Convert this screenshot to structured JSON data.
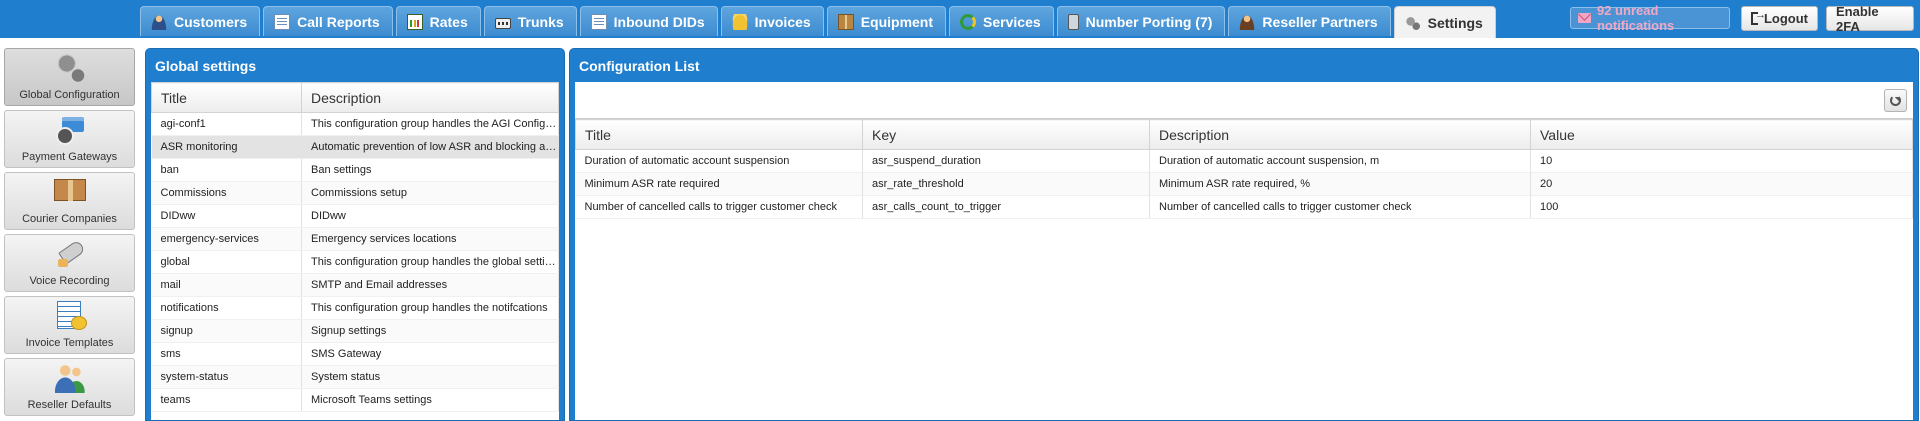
{
  "nav": {
    "tabs": [
      {
        "label": "Customers",
        "icon": "person-icon"
      },
      {
        "label": "Call Reports",
        "icon": "report-icon"
      },
      {
        "label": "Rates",
        "icon": "chart-icon"
      },
      {
        "label": "Trunks",
        "icon": "trunk-icon"
      },
      {
        "label": "Inbound DIDs",
        "icon": "did-icon"
      },
      {
        "label": "Invoices",
        "icon": "coins-icon"
      },
      {
        "label": "Equipment",
        "icon": "box-icon"
      },
      {
        "label": "Services",
        "icon": "services-icon"
      },
      {
        "label": "Number Porting (7)",
        "icon": "phone-icon"
      },
      {
        "label": "Reseller Partners",
        "icon": "reseller-icon"
      },
      {
        "label": "Settings",
        "icon": "gears-icon",
        "active": true
      }
    ],
    "notifications": "92 unread notifications",
    "logout": "Logout",
    "enable_2fa": "Enable 2FA"
  },
  "sidebar": {
    "items": [
      {
        "label": "Global Configuration",
        "icon": "gears-icon"
      },
      {
        "label": "Payment Gateways",
        "icon": "payment-card-icon"
      },
      {
        "label": "Courier Companies",
        "icon": "box-icon"
      },
      {
        "label": "Voice Recording",
        "icon": "megaphone-icon"
      },
      {
        "label": "Invoice Templates",
        "icon": "invoice-icon"
      },
      {
        "label": "Reseller Defaults",
        "icon": "reseller-icon"
      }
    ]
  },
  "global_settings": {
    "title": "Global settings",
    "columns": [
      "Title",
      "Description"
    ],
    "rows": [
      [
        "agi-conf1",
        "This configuration group handles the AGI Configuration"
      ],
      [
        "ASR monitoring",
        "Automatic prevention of low ASR and blocking accounts"
      ],
      [
        "ban",
        "Ban settings"
      ],
      [
        "Commissions",
        "Commissions setup"
      ],
      [
        "DIDww",
        "DIDww"
      ],
      [
        "emergency-services",
        "Emergency services locations"
      ],
      [
        "global",
        "This configuration group handles the global settings"
      ],
      [
        "mail",
        "SMTP and Email addresses"
      ],
      [
        "notifications",
        "This configuration group handles the notifcations"
      ],
      [
        "signup",
        "Signup settings"
      ],
      [
        "sms",
        "SMS Gateway"
      ],
      [
        "system-status",
        "System status"
      ],
      [
        "teams",
        "Microsoft Teams settings"
      ]
    ],
    "selected_row": "ASR monitoring"
  },
  "config_list": {
    "title": "Configuration List",
    "columns": [
      "Title",
      "Key",
      "Description",
      "Value"
    ],
    "rows": [
      [
        "Duration of automatic account suspension",
        "asr_suspend_duration",
        "Duration of automatic account suspension, m",
        "10"
      ],
      [
        "Minimum ASR rate required",
        "asr_rate_threshold",
        "Minimum ASR rate required, %",
        "20"
      ],
      [
        "Number of cancelled calls to trigger customer check",
        "asr_calls_count_to_trigger",
        "Number of cancelled calls to trigger customer check",
        "100"
      ]
    ]
  }
}
